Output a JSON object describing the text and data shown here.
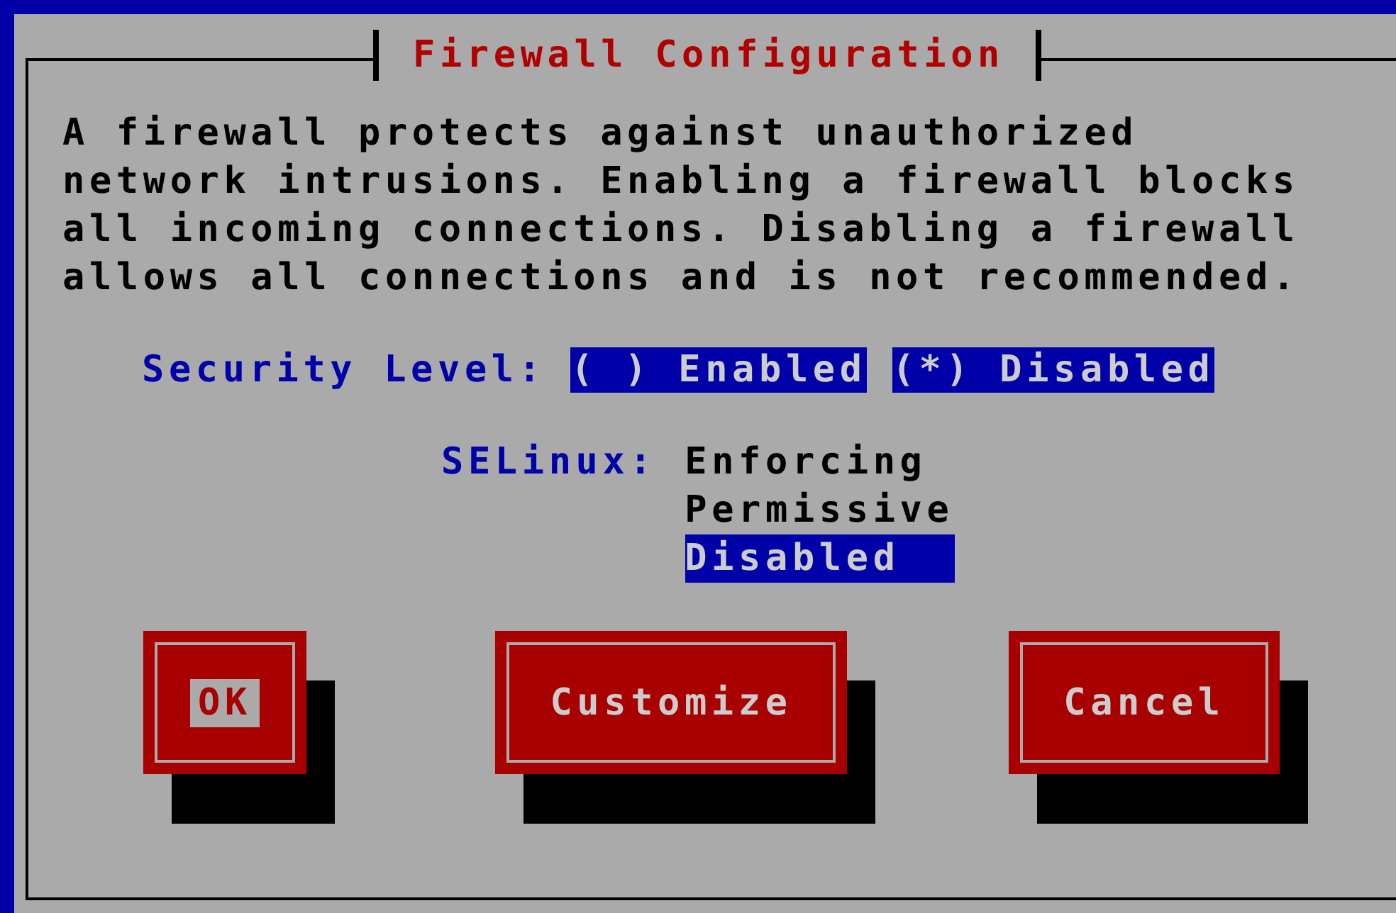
{
  "dialog": {
    "title": "Firewall Configuration",
    "description": [
      "A firewall protects against unauthorized",
      "network intrusions. Enabling a firewall blocks",
      "all incoming connections. Disabling a firewall",
      "allows all connections and is not recommended."
    ],
    "security_level": {
      "label": "Security Level:",
      "options": [
        {
          "label": "( ) Enabled"
        },
        {
          "label": "(*) Disabled"
        }
      ]
    },
    "selinux": {
      "label": "SELinux:",
      "options": [
        {
          "label": "Enforcing",
          "selected": false
        },
        {
          "label": "Permissive",
          "selected": false
        },
        {
          "label": "Disabled",
          "selected": true
        }
      ]
    },
    "buttons": [
      {
        "label": "OK",
        "focused": true
      },
      {
        "label": "Customize",
        "focused": false
      },
      {
        "label": "Cancel",
        "focused": false
      }
    ]
  }
}
